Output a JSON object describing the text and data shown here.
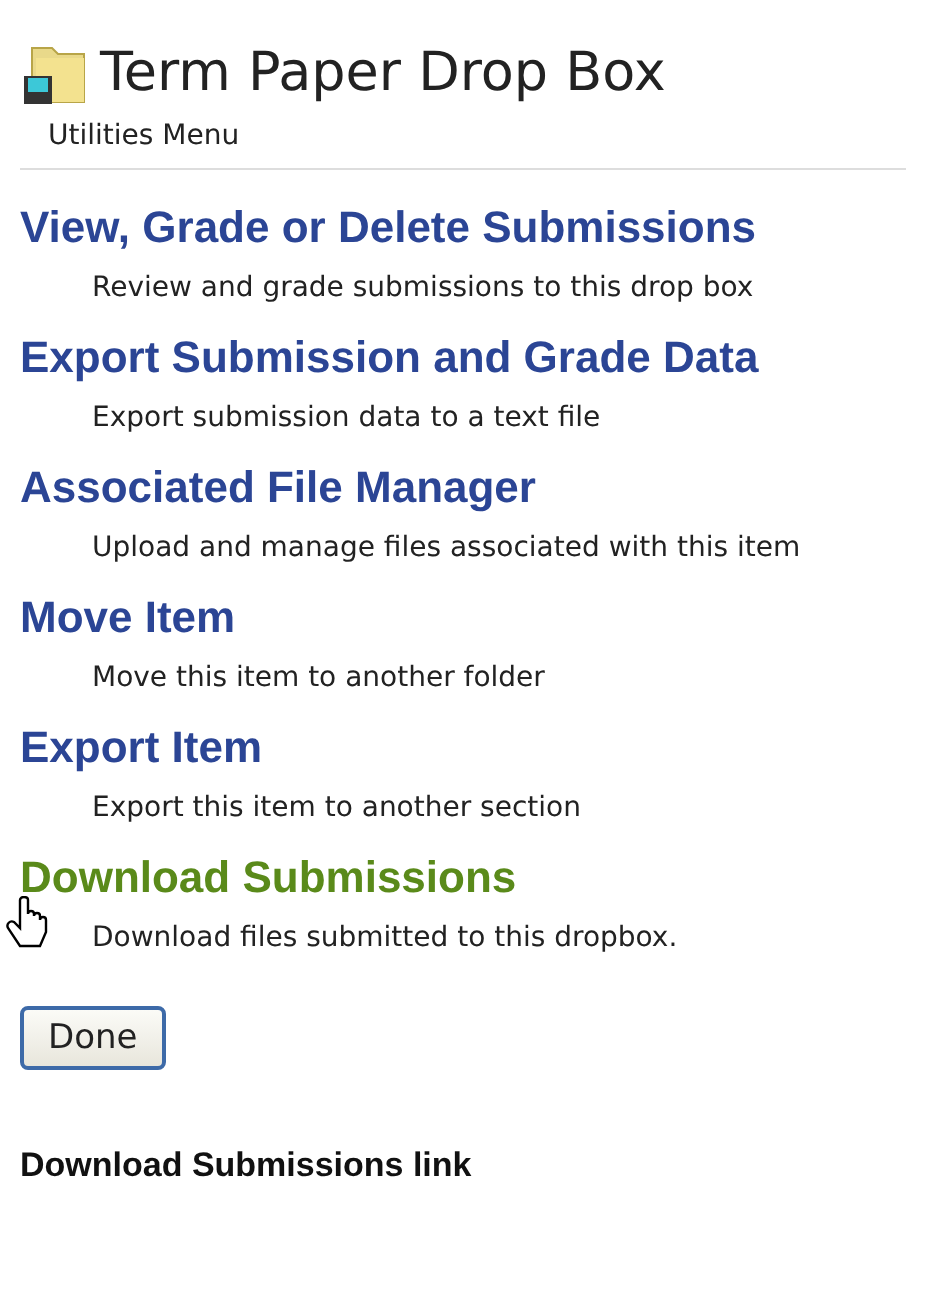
{
  "header": {
    "title": "Term Paper Drop Box",
    "subtitle": "Utilities Menu"
  },
  "items": [
    {
      "label": "View, Grade or Delete Submissions",
      "description": "Review and grade submissions to this drop box",
      "hovered": false
    },
    {
      "label": "Export Submission and Grade Data",
      "description": "Export submission data to a text file",
      "hovered": false
    },
    {
      "label": "Associated File Manager",
      "description": "Upload and manage files associated with this item",
      "hovered": false
    },
    {
      "label": "Move Item",
      "description": "Move this item to another folder",
      "hovered": false
    },
    {
      "label": "Export Item",
      "description": "Export this item to another section",
      "hovered": false
    },
    {
      "label": "Download Submissions",
      "description": "Download files submitted to this dropbox.",
      "hovered": true
    }
  ],
  "button": "Done",
  "caption": "Download Submissions link"
}
